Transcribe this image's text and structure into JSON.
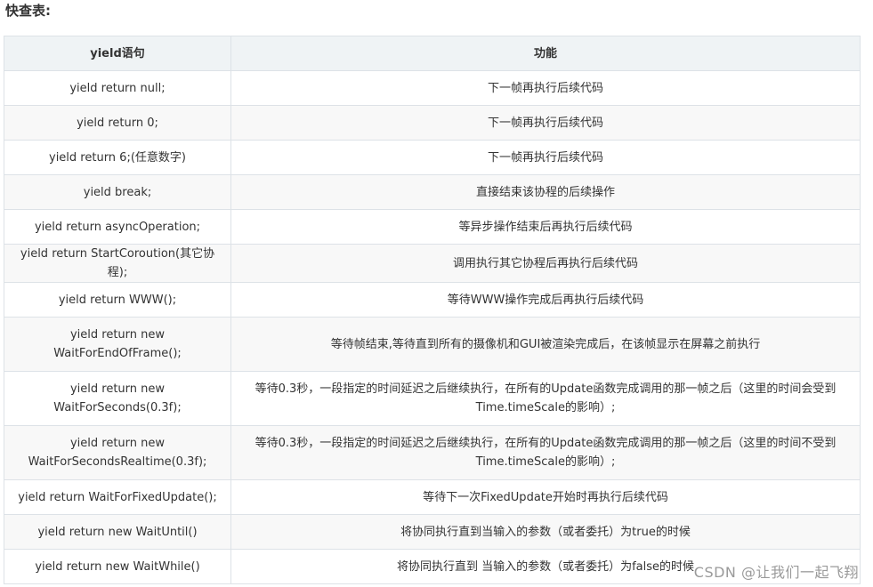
{
  "heading": "快查表:",
  "table": {
    "headers": [
      "yield语句",
      "功能"
    ],
    "rows": [
      {
        "stmt": "yield return null;",
        "desc": "下一帧再执行后续代码"
      },
      {
        "stmt": "yield return 0;",
        "desc": "下一帧再执行后续代码"
      },
      {
        "stmt": "yield return 6;(任意数字)",
        "desc": "下一帧再执行后续代码"
      },
      {
        "stmt": "yield break;",
        "desc": "直接结束该协程的后续操作"
      },
      {
        "stmt": "yield return asyncOperation;",
        "desc": "等异步操作结束后再执行后续代码"
      },
      {
        "stmt": "yield return StartCoroution(其它协程);",
        "desc": "调用执行其它协程后再执行后续代码"
      },
      {
        "stmt": "yield return WWW();",
        "desc": "等待WWW操作完成后再执行后续代码"
      },
      {
        "stmt": "yield return new WaitForEndOfFrame();",
        "desc": "等待帧结束,等待直到所有的摄像机和GUI被渲染完成后，在该帧显示在屏幕之前执行"
      },
      {
        "stmt": "yield return new WaitForSeconds(0.3f);",
        "desc": "等待0.3秒，一段指定的时间延迟之后继续执行，在所有的Update函数完成调用的那一帧之后（这里的时间会受到Time.timeScale的影响）;"
      },
      {
        "stmt": "yield return new WaitForSecondsRealtime(0.3f);",
        "desc": "等待0.3秒，一段指定的时间延迟之后继续执行，在所有的Update函数完成调用的那一帧之后（这里的时间不受到Time.timeScale的影响）;"
      },
      {
        "stmt": "yield return WaitForFixedUpdate();",
        "desc": "等待下一次FixedUpdate开始时再执行后续代码"
      },
      {
        "stmt": "yield return new WaitUntil()",
        "desc": "将协同执行直到当输入的参数（或者委托）为true的时候"
      },
      {
        "stmt": "yield return new WaitWhile()",
        "desc": "将协同执行直到 当输入的参数（或者委托）为false的时候"
      }
    ]
  },
  "watermark": "CSDN @让我们一起飞翔"
}
